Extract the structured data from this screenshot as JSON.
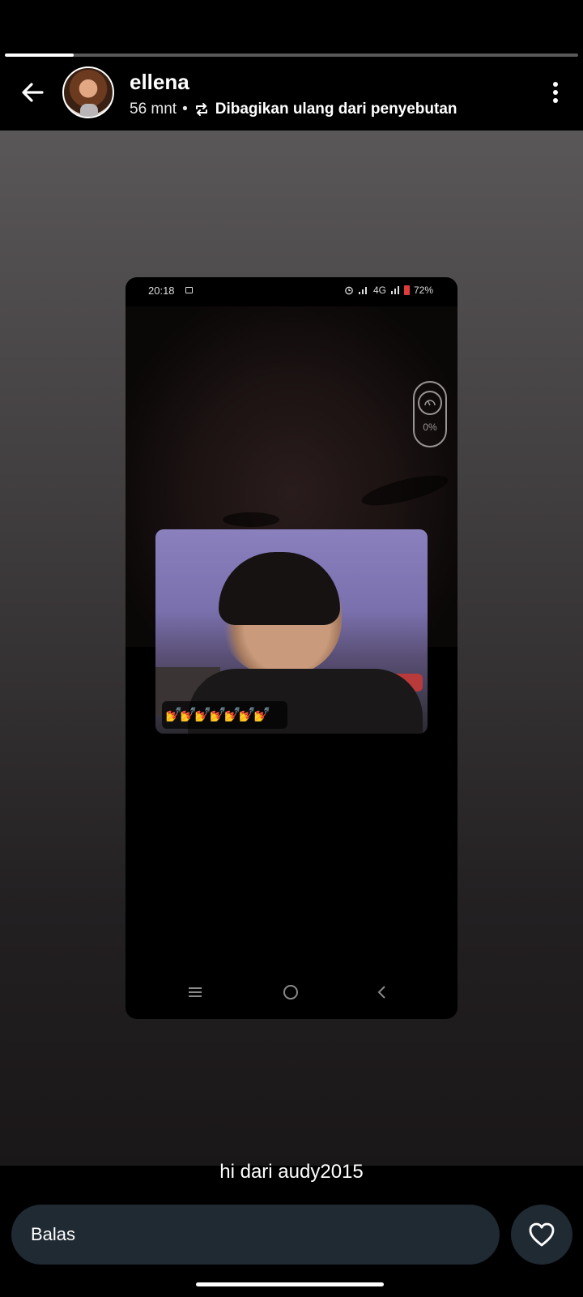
{
  "story": {
    "progress": 0.12,
    "username": "ellena",
    "time_ago": "56 mnt",
    "separator": "•",
    "reshare_label": "Dibagikan ulang dari penyebutan",
    "caption": "hi dari audy2015"
  },
  "shared_screenshot": {
    "status_time": "20:18",
    "status_network": "4G",
    "battery": "72%",
    "widget_percent": "0%",
    "reactions": "💅💅💅💅💅💅💅"
  },
  "reply": {
    "placeholder": "Balas"
  },
  "colors": {
    "reply_bg": "#1f2a33",
    "battery_low": "#e03b3b"
  },
  "icons": {
    "back": "arrow-left-icon",
    "reshare": "repost-icon",
    "more": "more-vertical-icon",
    "like": "heart-outline-icon"
  }
}
